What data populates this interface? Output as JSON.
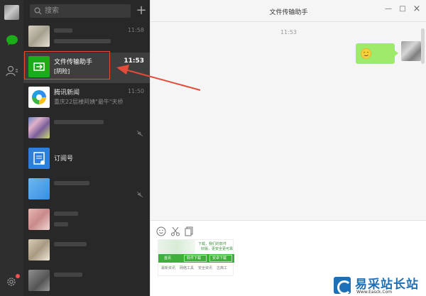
{
  "search": {
    "placeholder": "搜索"
  },
  "add_label": "+",
  "chats": [
    {
      "time": "11:58"
    },
    {
      "title": "文件传输助手",
      "preview": "[阴险]",
      "time": "11:53"
    },
    {
      "title": "腾讯新闻",
      "preview": "重庆22层楼阿姨\"最牛\"天桥",
      "time": "11:50"
    },
    {},
    {
      "title": "订阅号"
    },
    {},
    {},
    {},
    {}
  ],
  "main": {
    "title": "文件传输助手",
    "timestamp": "11:53",
    "minimize_label": "—",
    "maximize_label": "□",
    "close_label": "×"
  },
  "pasted_image": {
    "small_top": "下载，我们的软件",
    "small_top2": "好版，更安全更可靠",
    "buttons": [
      "首页",
      "软件下载",
      "安卓下载"
    ],
    "footer": [
      "最新资讯",
      "网络工具",
      "安全资讯",
      "古典工"
    ]
  },
  "watermark": {
    "brand": "易采站长站",
    "domain": "Www.Easck.Com"
  },
  "colors": {
    "accent_green": "#1aad19",
    "bubble_green": "#9eea6a",
    "highlight_red": "#e24c3a"
  }
}
